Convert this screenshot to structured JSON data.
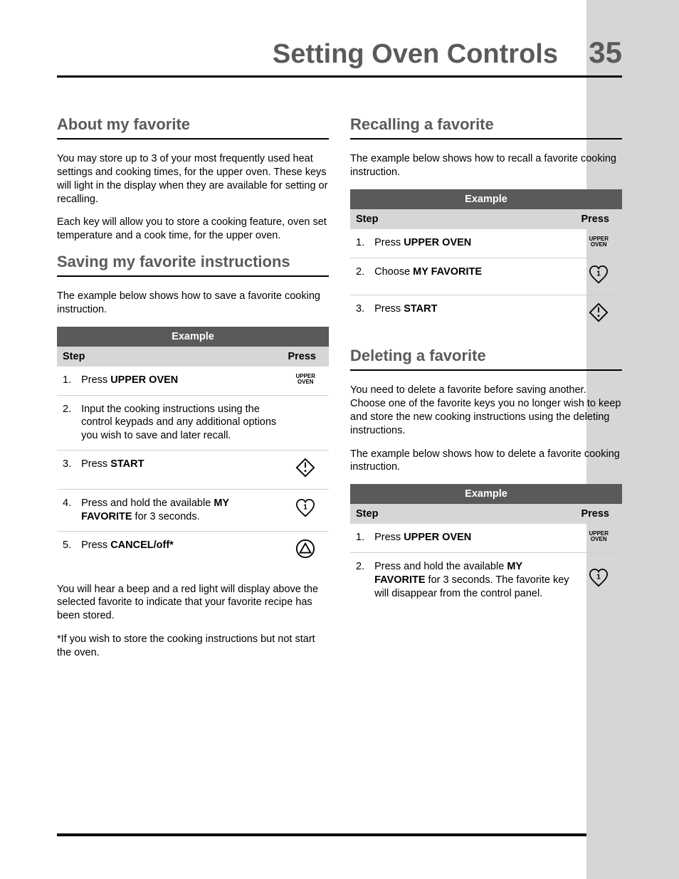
{
  "header": {
    "title": "Setting Oven Controls",
    "page_number": "35"
  },
  "left": {
    "section1": {
      "heading": "About my favorite",
      "para1": "You may store up to 3 of your most frequently used heat settings and cooking times, for the upper oven. These keys will light in the display when they are available for setting or recalling.",
      "para2": "Each key will allow you to store a cooking feature, oven set temperature and a cook time, for the upper oven."
    },
    "section2": {
      "heading": "Saving my favorite instructions",
      "intro": "The example below shows how to save a favorite cooking instruction.",
      "table": {
        "title": "Example",
        "hstep": "Step",
        "hpress": "Press",
        "rows": [
          {
            "n": "1.",
            "text_a": "Press ",
            "bold": "UPPER OVEN",
            "text_b": "",
            "icon": "upper-oven"
          },
          {
            "n": "2.",
            "text_a": "Input the cooking instructions using the control keypads and any additional options you wish to save and later recall.",
            "bold": "",
            "text_b": "",
            "icon": ""
          },
          {
            "n": "3.",
            "text_a": "Press ",
            "bold": "START",
            "text_b": "",
            "icon": "start"
          },
          {
            "n": "4.",
            "text_a": "Press and hold the available ",
            "bold": "MY FAVORITE",
            "text_b": " for 3 seconds.",
            "icon": "favorite"
          },
          {
            "n": "5.",
            "text_a": "Press ",
            "bold": "CANCEL/off*",
            "text_b": "",
            "icon": "cancel"
          }
        ]
      },
      "after1": "You will hear a beep and a red light will display above the selected favorite to indicate that your favorite recipe has been stored.",
      "after2": "*If you wish to store the cooking instructions but not start the oven."
    }
  },
  "right": {
    "section1": {
      "heading": "Recalling a favorite",
      "intro": "The example below shows how to recall a favorite cooking instruction.",
      "table": {
        "title": "Example",
        "hstep": "Step",
        "hpress": "Press",
        "rows": [
          {
            "n": "1.",
            "text_a": "Press ",
            "bold": "UPPER OVEN",
            "text_b": "",
            "icon": "upper-oven"
          },
          {
            "n": "2.",
            "text_a": "Choose ",
            "bold": "MY FAVORITE",
            "text_b": "",
            "icon": "favorite"
          },
          {
            "n": "3.",
            "text_a": "Press ",
            "bold": "START",
            "text_b": "",
            "icon": "start"
          }
        ]
      }
    },
    "section2": {
      "heading": "Deleting a favorite",
      "para1": "You need to delete a favorite before saving another. Choose one of the favorite keys you no longer wish to keep and store the new cooking instructions using the deleting instructions.",
      "para2": "The example below shows how to delete a favorite cooking instruction.",
      "table": {
        "title": "Example",
        "hstep": "Step",
        "hpress": "Press",
        "rows": [
          {
            "n": "1.",
            "text_a": "Press ",
            "bold": "UPPER OVEN",
            "text_b": "",
            "icon": "upper-oven"
          },
          {
            "n": "2.",
            "text_a": "Press and hold the available ",
            "bold": "MY FAVORITE",
            "text_b": " for 3 seconds. The favorite key will disappear from the control panel.",
            "icon": "favorite"
          }
        ]
      }
    }
  },
  "icons": {
    "upper_oven_line1": "UPPER",
    "upper_oven_line2": "OVEN",
    "favorite_num": "1"
  }
}
